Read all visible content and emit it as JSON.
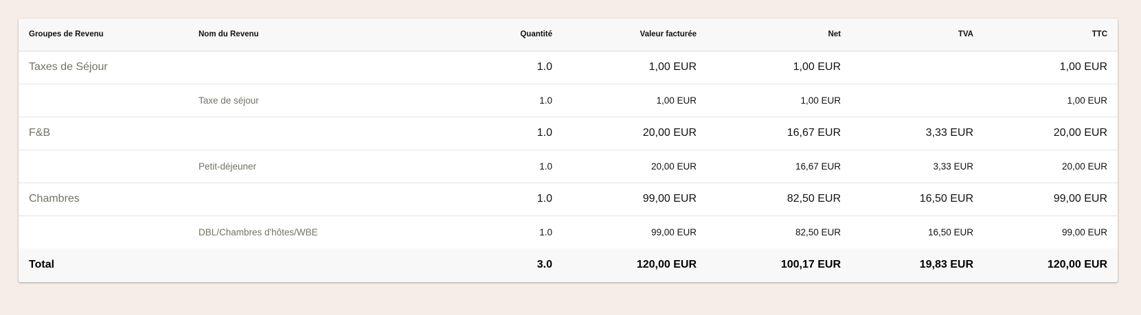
{
  "table": {
    "columns": {
      "group": "Groupes de Revenu",
      "name": "Nom du Revenu",
      "quantity": "Quantité",
      "billed": "Valeur facturée",
      "net": "Net",
      "vat": "TVA",
      "ttc": "TTC"
    },
    "rows": [
      {
        "group": "Taxes de Séjour",
        "name": "",
        "quantity": "1.0",
        "billed": "1,00 EUR",
        "net": "1,00 EUR",
        "vat": "",
        "ttc": "1,00 EUR"
      },
      {
        "group": "",
        "name": "Taxe de séjour",
        "quantity": "1.0",
        "billed": "1,00 EUR",
        "net": "1,00 EUR",
        "vat": "",
        "ttc": "1,00 EUR"
      },
      {
        "group": "F&B",
        "name": "",
        "quantity": "1.0",
        "billed": "20,00 EUR",
        "net": "16,67 EUR",
        "vat": "3,33 EUR",
        "ttc": "20,00 EUR"
      },
      {
        "group": "",
        "name": "Petit-déjeuner",
        "quantity": "1.0",
        "billed": "20,00 EUR",
        "net": "16,67 EUR",
        "vat": "3,33 EUR",
        "ttc": "20,00 EUR"
      },
      {
        "group": "Chambres",
        "name": "",
        "quantity": "1.0",
        "billed": "99,00 EUR",
        "net": "82,50 EUR",
        "vat": "16,50 EUR",
        "ttc": "99,00 EUR"
      },
      {
        "group": "",
        "name": "DBL/Chambres d'hôtes/WBE",
        "quantity": "1.0",
        "billed": "99,00 EUR",
        "net": "82,50 EUR",
        "vat": "16,50 EUR",
        "ttc": "99,00 EUR"
      }
    ],
    "total": {
      "label": "Total",
      "quantity": "3.0",
      "billed": "120,00 EUR",
      "net": "100,17 EUR",
      "vat": "19,83 EUR",
      "ttc": "120,00 EUR"
    }
  }
}
